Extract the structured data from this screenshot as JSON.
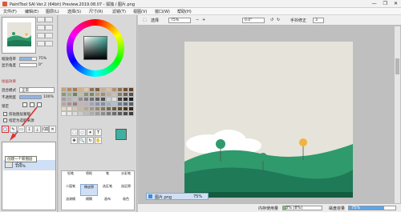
{
  "window": {
    "title": "PaintTool SAI Ver.2 (64bit) Preview.2019.08.07 - 狐独 / 图片.png",
    "controls": [
      "—",
      "❐",
      "✕"
    ]
  },
  "menu": [
    "文件(F)",
    "编辑(E)",
    "图层(L)",
    "选择(S)",
    "尺寸(R)",
    "滤镜(T)",
    "视图(V)",
    "窗口(W)",
    "帮助(H)"
  ],
  "navigator": {
    "zoom_label": "缩放倍率",
    "zoom_value": "75%",
    "angle_label": "显示角度",
    "angle_value": "0°"
  },
  "layer_panel": {
    "effects_header": "绘画效果",
    "blend_label": "混合模式",
    "blend_value": "正常",
    "opacity_label": "不透明度",
    "opacity_value": "100%",
    "lock_label": "锁定",
    "clip_group": "剪贴图层蒙版",
    "ref_layer": "指定为选取来源",
    "tooltip": "创建一个新图层",
    "layers": [
      {
        "name": "正常",
        "opacity": "100%"
      }
    ]
  },
  "toolbar2": {
    "select_label": "选择",
    "zoom_value": "75%",
    "angle_value": "0.0°",
    "stabilizer_label": "手抖修正",
    "stabilizer_value": "3"
  },
  "document_tab": {
    "name": "图片.png",
    "zoom": "75%"
  },
  "status": {
    "memory_label": "内存使用量",
    "memory_value": "3% (8%)",
    "disk_label": "磁盘容量",
    "disk_value": "75%"
  },
  "brushes": [
    "铅笔",
    "喷枪",
    "笔",
    "水彩笔",
    "二值笔",
    "橡皮擦",
    "选区笔",
    "选区擦",
    "油漆桶",
    "模糊",
    "画布",
    "吸色",
    "扩散",
    "马克笔"
  ],
  "colors": {
    "accent": "#3c8cd6",
    "hill_dark": "#1f7a57",
    "hill_mid": "#2f9a6c",
    "sky": "#e6e3da"
  }
}
